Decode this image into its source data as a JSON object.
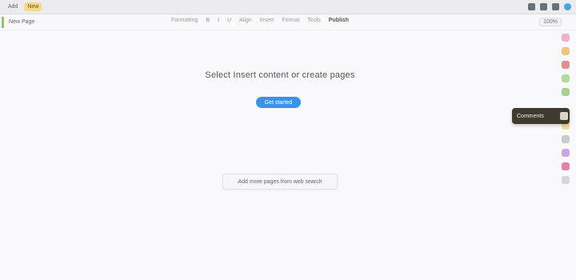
{
  "topbar": {
    "tabs": [
      {
        "label": "Add",
        "active": false
      },
      {
        "label": "New",
        "active": true
      }
    ],
    "icons": [
      {
        "name": "grid-icon",
        "color": "#6b6f76"
      },
      {
        "name": "cast-icon",
        "color": "#6b6f76"
      },
      {
        "name": "extension-icon",
        "color": "#6b6f76"
      },
      {
        "name": "profile-icon",
        "color": "#4aa3df"
      }
    ]
  },
  "toolbar": {
    "new_page_label": "New Page",
    "menu": [
      "Formatting",
      "B",
      "I",
      "U",
      "Align",
      "Insert",
      "Format",
      "Tools",
      "Publish"
    ],
    "zoom": "100%"
  },
  "content": {
    "empty_message": "Select Insert content or create pages",
    "primary_button": "Get started",
    "secondary_button": "Add more pages from web search"
  },
  "rail": {
    "items": [
      {
        "name": "rail-pink-icon",
        "color": "#e79ab4"
      },
      {
        "name": "rail-orange-icon",
        "color": "#e9b25a"
      },
      {
        "name": "rail-red-icon",
        "color": "#d86b6b"
      },
      {
        "name": "rail-green-icon",
        "color": "#9ccf7a"
      },
      {
        "name": "rail-green2-icon",
        "color": "#8cc66a"
      },
      {
        "name": "rail-yellow-icon",
        "color": "#f0d27a"
      },
      {
        "name": "rail-gray-icon",
        "color": "#b7b7bd"
      },
      {
        "name": "rail-purple-icon",
        "color": "#b58cd8"
      },
      {
        "name": "rail-magenta-icon",
        "color": "#d85a8c"
      },
      {
        "name": "rail-lightgray-icon",
        "color": "#c9c9cf"
      }
    ],
    "tooltip": "Comments"
  }
}
